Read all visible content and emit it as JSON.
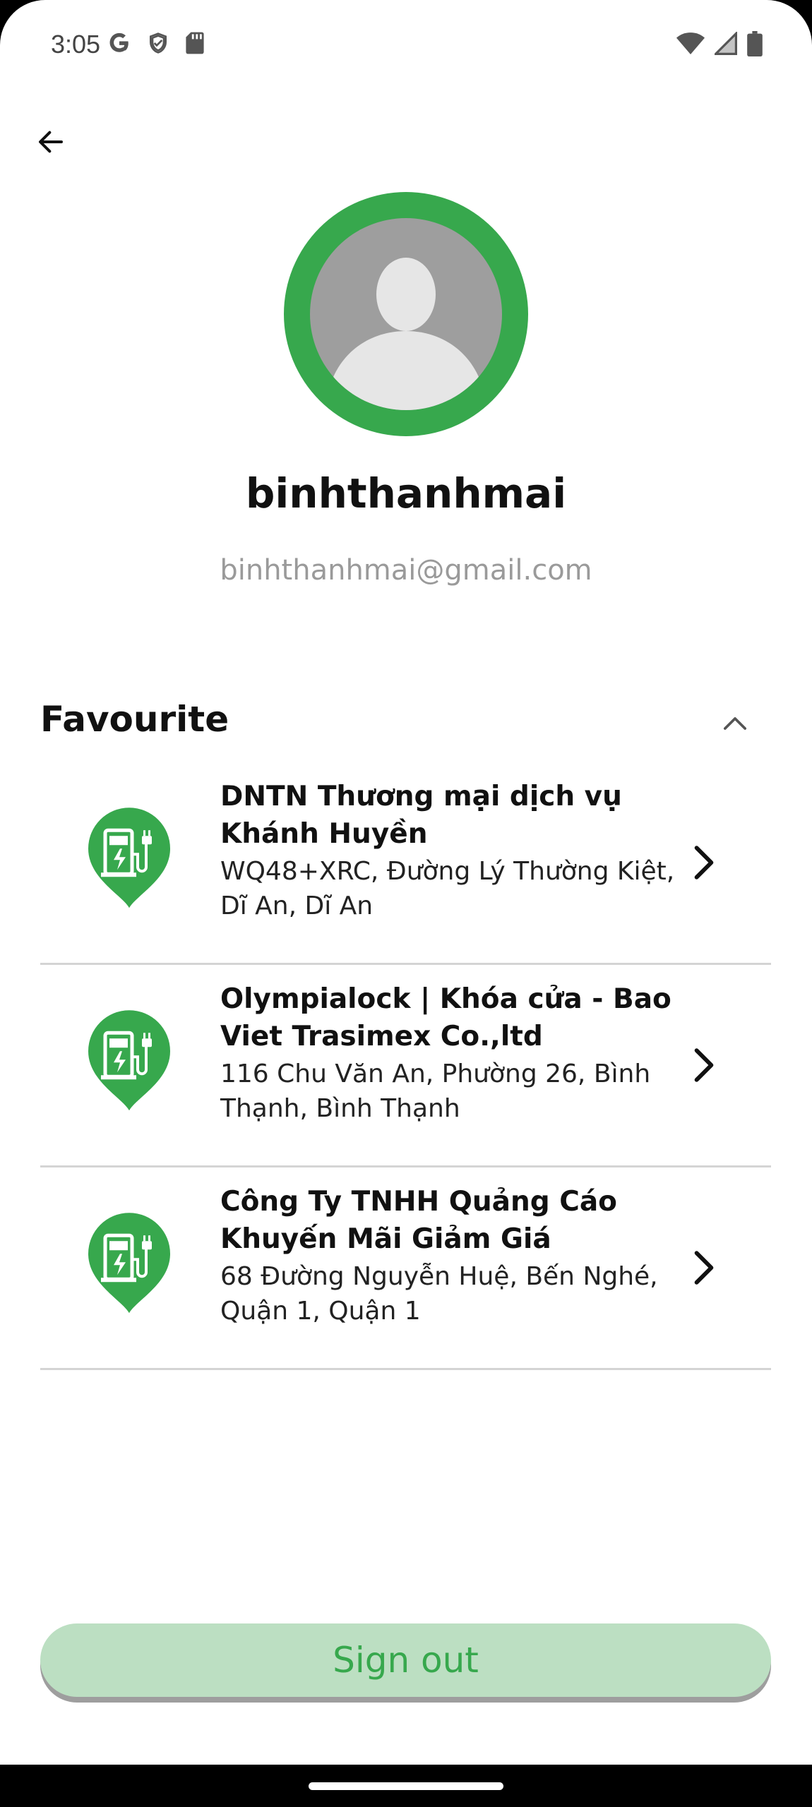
{
  "status_bar": {
    "time": "3:05",
    "left_icons": [
      "google-icon",
      "shield-icon",
      "sd-card-icon"
    ],
    "right_icons": [
      "wifi-icon",
      "signal-icon",
      "battery-icon"
    ]
  },
  "profile": {
    "username": "binhthanhmai",
    "email": "binhthanhmai@gmail.com"
  },
  "favourite": {
    "title": "Favourite",
    "items": [
      {
        "name": "DNTN Thương mại dịch vụ Khánh Huyền",
        "address": "WQ48+XRC, Đường Lý Thường Kiệt, Dĩ An, Dĩ An"
      },
      {
        "name": "Olympialock | Khóa cửa - Bao Viet Trasimex Co.,ltd",
        "address": "116 Chu Văn An, Phường 26, Bình Thạnh, Bình Thạnh"
      },
      {
        "name": "Công Ty TNHH Quảng Cáo Khuyến Mãi Giảm Giá",
        "address": "68 Đường Nguyễn Huệ, Bến Nghé, Quận 1, Quận 1"
      }
    ]
  },
  "signout_label": "Sign out",
  "colors": {
    "accent": "#37a84d",
    "signout_bg": "#bcdfc2",
    "avatar_bg": "#9e9e9e"
  }
}
